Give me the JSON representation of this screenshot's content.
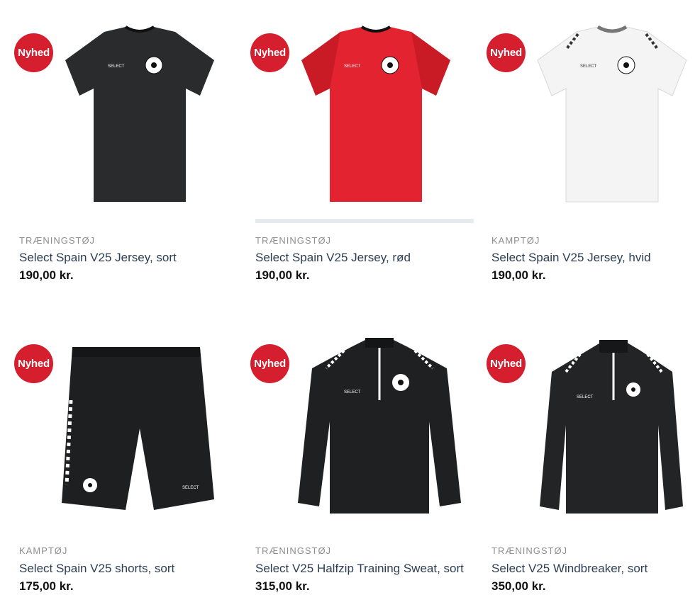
{
  "products": [
    {
      "badge": "Nyhed",
      "category": "TRÆNINGSTØJ",
      "title": "Select Spain V25 Jersey, sort",
      "price": "190,00 kr.",
      "color": "#2a2b2d",
      "type": "tshirt"
    },
    {
      "badge": "Nyhed",
      "category": "TRÆNINGSTØJ",
      "title": "Select Spain V25 Jersey, rød",
      "price": "190,00 kr.",
      "color": "#e3232f",
      "type": "tshirt"
    },
    {
      "badge": "Nyhed",
      "category": "KAMPTØJ",
      "title": "Select Spain V25 Jersey, hvid",
      "price": "190,00 kr.",
      "color": "#f4f4f4",
      "type": "tshirt"
    },
    {
      "badge": "Nyhed",
      "category": "KAMPTØJ",
      "title": "Select Spain V25 shorts, sort",
      "price": "175,00 kr.",
      "color": "#1e1f21",
      "type": "shorts"
    },
    {
      "badge": "Nyhed",
      "category": "TRÆNINGSTØJ",
      "title": "Select V25 Halfzip Training Sweat, sort",
      "price": "315,00 kr.",
      "color": "#1f2022",
      "type": "halfzip"
    },
    {
      "badge": "Nyhed",
      "category": "TRÆNINGSTØJ",
      "title": "Select V25 Windbreaker, sort",
      "price": "350,00 kr.",
      "color": "#232426",
      "type": "jacket"
    }
  ],
  "colors": {
    "badge": "#d51f2e",
    "title": "#2c3e55",
    "category": "#8e8e8e"
  }
}
